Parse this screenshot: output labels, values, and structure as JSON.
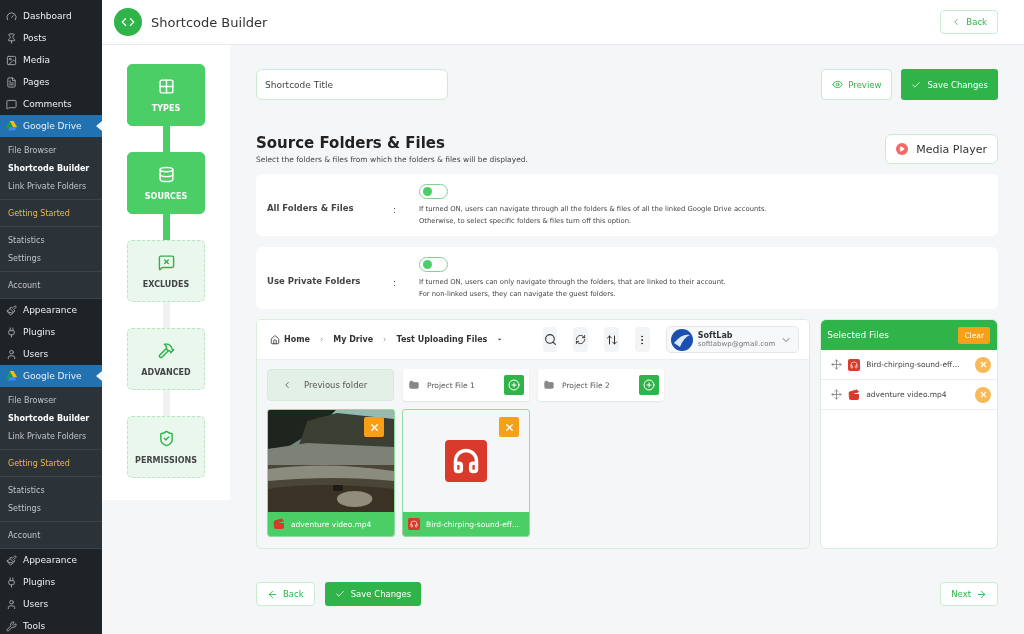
{
  "header": {
    "title": "Shortcode Builder",
    "back_button": "Back"
  },
  "sidebar": {
    "sections": [
      {
        "kind": "menu",
        "items": [
          {
            "label": "Dashboard",
            "current": false
          },
          {
            "label": "Posts",
            "current": false
          },
          {
            "label": "Media",
            "current": false
          },
          {
            "label": "Pages",
            "current": false
          },
          {
            "label": "Comments",
            "current": false
          },
          {
            "label": "Google Drive",
            "current": true
          }
        ]
      },
      {
        "kind": "submenu",
        "items": [
          {
            "label": "File Browser",
            "selected": false
          },
          {
            "label": "Shortcode Builder",
            "selected": true
          },
          {
            "label": "Link Private Folders",
            "selected": false
          }
        ]
      },
      {
        "kind": "promo",
        "items": [
          {
            "label": "Getting Started",
            "selected": false
          }
        ]
      },
      {
        "kind": "submenu",
        "items": [
          {
            "label": "Statistics",
            "selected": false
          },
          {
            "label": "Settings",
            "selected": false
          }
        ]
      },
      {
        "kind": "submenu",
        "items": [
          {
            "label": "Account",
            "selected": false
          }
        ]
      },
      {
        "kind": "menu",
        "items": [
          {
            "label": "Appearance",
            "current": false
          },
          {
            "label": "Plugins",
            "current": false
          },
          {
            "label": "Users",
            "current": false
          },
          {
            "label": "Google Drive",
            "current": true
          }
        ]
      },
      {
        "kind": "submenu",
        "items": [
          {
            "label": "File Browser",
            "selected": false
          },
          {
            "label": "Shortcode Builder",
            "selected": true
          },
          {
            "label": "Link Private Folders",
            "selected": false
          }
        ]
      },
      {
        "kind": "promo",
        "items": [
          {
            "label": "Getting Started",
            "selected": false
          }
        ]
      },
      {
        "kind": "submenu",
        "items": [
          {
            "label": "Statistics",
            "selected": false
          },
          {
            "label": "Settings",
            "selected": false
          }
        ]
      },
      {
        "kind": "submenu",
        "items": [
          {
            "label": "Account",
            "selected": false
          }
        ]
      },
      {
        "kind": "menu",
        "items": [
          {
            "label": "Appearance",
            "current": false
          },
          {
            "label": "Plugins",
            "current": false
          },
          {
            "label": "Users",
            "current": false
          },
          {
            "label": "Tools",
            "current": false
          }
        ]
      }
    ]
  },
  "steps": [
    {
      "label": "TYPES",
      "completed": true
    },
    {
      "label": "SOURCES",
      "completed": true
    },
    {
      "label": "EXCLUDES",
      "completed": false
    },
    {
      "label": "ADVANCED",
      "completed": false
    },
    {
      "label": "PERMISSIONS",
      "completed": false
    }
  ],
  "title_field": {
    "placeholder": "Shortcode Title"
  },
  "preview_button": "Preview",
  "save_button": "Save Changes",
  "section": {
    "title": "Source Folders & Files",
    "subtitle": "Select the folders & files from which the folders & files will be displayed.",
    "media_button": "Media Player"
  },
  "options": [
    {
      "label": "All Folders & Files",
      "separator": ":",
      "on": false,
      "description": [
        "If turned ON, users can navigate through all the folders & files of all the linked Google Drive accounts.",
        "Otherwise, to select specific folders & files turn off this option."
      ]
    },
    {
      "label": "Use Private Folders",
      "separator": ":",
      "on": false,
      "description": [
        "If turned ON, users can only navigate through the folders, that are linked to their account.",
        "For non-linked users, they can navigate the guest folders."
      ]
    }
  ],
  "browser": {
    "breadcrumbs": [
      "Home",
      "My Drive",
      "Test Uploading Files"
    ],
    "account": {
      "name": "SoftLab",
      "email": "softlabwp@gmail.com"
    },
    "previous_folder": "Previous folder",
    "folders": [
      {
        "name": "Project File 1"
      },
      {
        "name": "Project File 2"
      }
    ],
    "files": [
      {
        "name": "adventure video.mp4",
        "kind": "video"
      },
      {
        "name": "Bird-chirping-sound-eff...",
        "kind": "audio"
      }
    ]
  },
  "selected_files": {
    "title": "Selected Files",
    "clear_button": "Clear",
    "items": [
      {
        "name": "Bird-chirping-sound-eff...",
        "kind": "audio"
      },
      {
        "name": "adventure video.mp4",
        "kind": "video"
      }
    ]
  },
  "footer": {
    "back_button": "Back",
    "save_button": "Save Changes",
    "next_button": "Next"
  }
}
